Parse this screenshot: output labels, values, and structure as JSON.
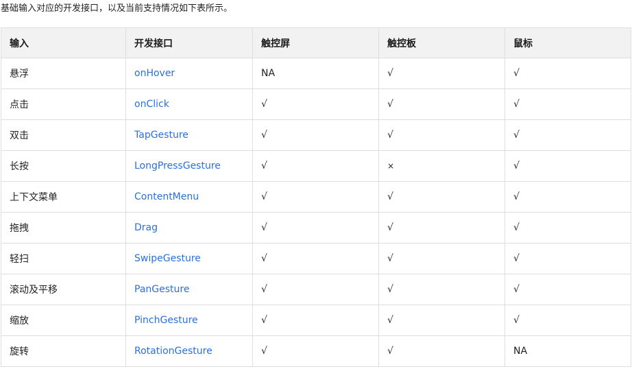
{
  "intro": "基础输入对应的开发接口，以及当前支持情况如下表所示。",
  "table": {
    "headers": [
      "输入",
      "开发接口",
      "触控屏",
      "触控板",
      "鼠标"
    ],
    "rows": [
      {
        "input": "悬浮",
        "api": "onHover",
        "touchscreen": "NA",
        "touchpad": "√",
        "mouse": "√"
      },
      {
        "input": "点击",
        "api": "onClick",
        "touchscreen": "√",
        "touchpad": "√",
        "mouse": "√"
      },
      {
        "input": "双击",
        "api": "TapGesture",
        "touchscreen": "√",
        "touchpad": "√",
        "mouse": "√"
      },
      {
        "input": "长按",
        "api": "LongPressGesture",
        "touchscreen": "√",
        "touchpad": "×",
        "mouse": "√"
      },
      {
        "input": "上下文菜单",
        "api": "ContentMenu",
        "touchscreen": "√",
        "touchpad": "√",
        "mouse": "√"
      },
      {
        "input": "拖拽",
        "api": "Drag",
        "touchscreen": "√",
        "touchpad": "√",
        "mouse": "√"
      },
      {
        "input": "轻扫",
        "api": "SwipeGesture",
        "touchscreen": "√",
        "touchpad": "√",
        "mouse": "√"
      },
      {
        "input": "滚动及平移",
        "api": "PanGesture",
        "touchscreen": "√",
        "touchpad": "√",
        "mouse": "√"
      },
      {
        "input": "缩放",
        "api": "PinchGesture",
        "touchscreen": "√",
        "touchpad": "√",
        "mouse": "√"
      },
      {
        "input": "旋转",
        "api": "RotationGesture",
        "touchscreen": "√",
        "touchpad": "√",
        "mouse": "NA"
      }
    ]
  },
  "colors": {
    "link": "#2a6fdb",
    "header_bg": "#f2f2f2",
    "border": "#dedede"
  }
}
